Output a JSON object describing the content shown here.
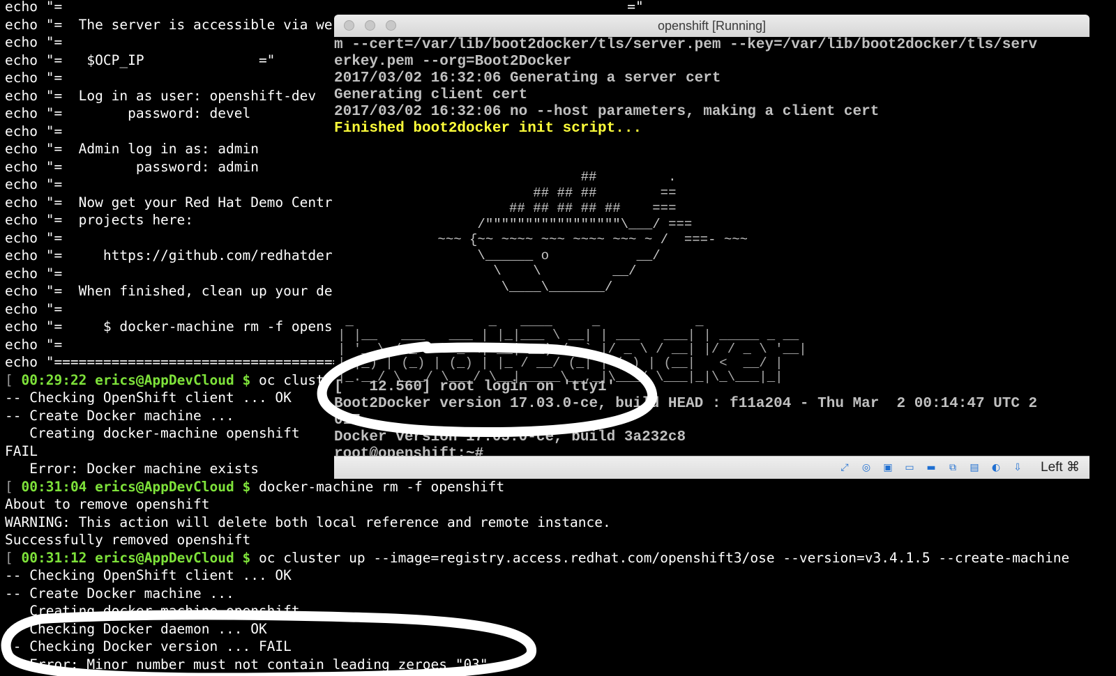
{
  "terminal": {
    "lines": [
      {
        "text": "echo \"=                                                                     =\""
      },
      {
        "text": "echo \"=  The server is accessible via we"
      },
      {
        "text": "echo \"="
      },
      {
        "text": "echo \"=   $OCP_IP              =\""
      },
      {
        "text": "echo \"="
      },
      {
        "text": "echo \"=  Log in as user: openshift-dev"
      },
      {
        "text": "echo \"=        password: devel"
      },
      {
        "text": "echo \"="
      },
      {
        "text": "echo \"=  Admin log in as: admin"
      },
      {
        "text": "echo \"=         password: admin"
      },
      {
        "text": "echo \"="
      },
      {
        "text": "echo \"=  Now get your Red Hat Demo Centr"
      },
      {
        "text": "echo \"=  projects here:"
      },
      {
        "text": "echo \"="
      },
      {
        "text": "echo \"=     https://github.com/redhatder"
      },
      {
        "text": "echo \"="
      },
      {
        "text": "echo \"=  When finished, clean up your de"
      },
      {
        "text": "echo \"="
      },
      {
        "text": "echo \"=     $ docker-machine rm -f opens"
      },
      {
        "text": "echo \"="
      },
      {
        "text": "echo \"============================================"
      },
      {
        "prompt": {
          "bracket": "[",
          "time": "00:29:22",
          "user": "erics@AppDevCloud $",
          "cmd": "oc clust"
        }
      },
      {
        "text": "-- Checking OpenShift client ... OK"
      },
      {
        "text": "-- Create Docker machine ..."
      },
      {
        "text": "   Creating docker-machine openshift"
      },
      {
        "text": "FAIL"
      },
      {
        "text": "   Error: Docker machine exists"
      },
      {
        "prompt": {
          "bracket": "[",
          "time": "00:31:04",
          "user": "erics@AppDevCloud $",
          "cmd": "docker-machine rm -f openshift"
        }
      },
      {
        "text": "About to remove openshift"
      },
      {
        "text": "WARNING: This action will delete both local reference and remote instance."
      },
      {
        "text": "Successfully removed openshift"
      },
      {
        "prompt": {
          "bracket": "[",
          "time": "00:31:12",
          "user": "erics@AppDevCloud $",
          "cmd": "oc cluster up --image=registry.access.redhat.com/openshift3/ose --version=v3.4.1.5 --create-machine"
        }
      },
      {
        "text": "-- Checking OpenShift client ... OK"
      },
      {
        "text": "-- Create Docker machine ..."
      },
      {
        "text": "   Creating docker-machine openshift"
      },
      {
        "text": "-- Checking Docker daemon ... OK"
      },
      {
        "text": "-- Checking Docker version ... FAIL"
      },
      {
        "text": "   Error: Minor number must not contain leading zeroes \"03\""
      }
    ]
  },
  "vm_window": {
    "title": "openshift [Running]",
    "lines": [
      {
        "text": "m --cert=/var/lib/boot2docker/tls/server.pem --key=/var/lib/boot2docker/tls/serv",
        "style": "normal"
      },
      {
        "text": "erkey.pem --org=Boot2Docker",
        "style": "normal"
      },
      {
        "text": "2017/03/02 16:32:06 Generating a server cert",
        "style": "normal"
      },
      {
        "text": "Generating client cert",
        "style": "normal"
      },
      {
        "text": "2017/03/02 16:32:06 no --host parameters, making a client cert",
        "style": "normal"
      },
      {
        "text": "Finished boot2docker init script...",
        "style": "yellow"
      }
    ],
    "ascii_whale": "                        ##         .\n                  ## ## ##        ==\n               ## ## ## ## ##    ===\n           /\"\"\"\"\"\"\"\"\"\"\"\"\"\"\"\"\"\\___/ ===\n      ~~~ {~~ ~~~~ ~~~ ~~~~ ~~~ ~ /  ===- ~~~\n           \\______ o           __/\n             \\    \\         __/\n              \\____\\_______/",
    "ascii_logo": " _                 _   ____     _            _\n| |__   ___   ___ | |_|___ \\ __| | ___   ___| | _____ _ __\n| '_ \\ / _ \\ / _ \\| __| __) / _` |/ _ \\ / __| |/ / _ \\ '__|\n| |_) | (_) | (_) | |_ / __/ (_| | (_) | (__|   <  __/ |\n|_.__/ \\___/ \\___/ \\__|_____\\__,_|\\___/ \\___|_|\\_\\___|_|",
    "lower_lines": [
      {
        "text": "[   12.560] root login on 'tty1'"
      },
      {
        "text": "Boot2Docker version 17.03.0-ce, build HEAD : f11a204 - Thu Mar  2 00:14:47 UTC 2"
      },
      {
        "text": "017"
      },
      {
        "text": "Docker version 17.03.0-ce, build 3a232c8"
      },
      {
        "text": "root@openshift:~# _"
      }
    ],
    "status_icons": [
      "resize-icon",
      "optical-disc-icon",
      "display-icon",
      "shared-folder-icon",
      "screen-icon",
      "network-icon",
      "usb-icon",
      "recording-icon",
      "mouse-integration-icon"
    ],
    "host_key": "Left ⌘"
  },
  "colors": {
    "prompt_green": "#7ee23a",
    "boot_yellow": "#ffff3a",
    "annotation": "#ffffff"
  }
}
